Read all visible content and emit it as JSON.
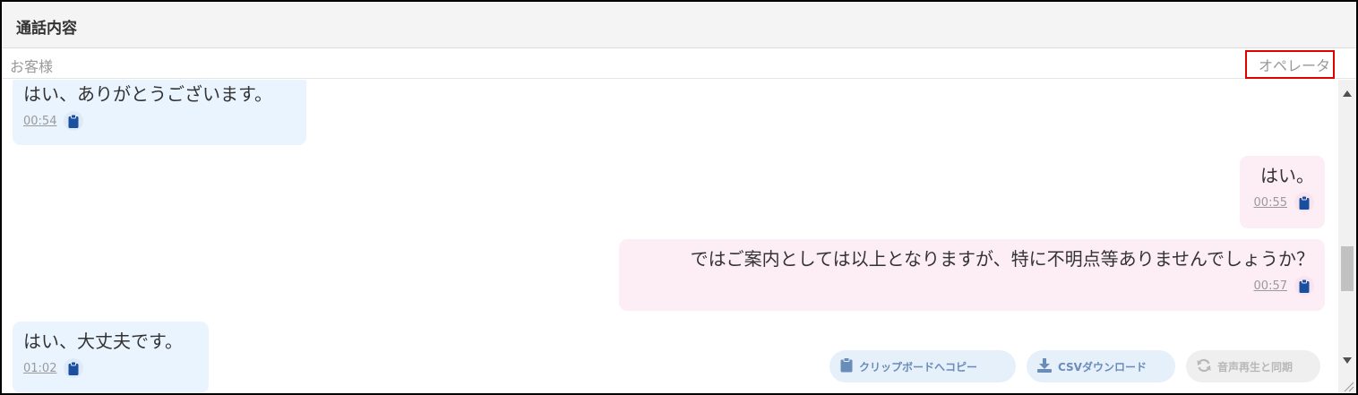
{
  "header": {
    "title": "通話内容"
  },
  "speakers": {
    "customer": "お客様",
    "operator": "オペレータ"
  },
  "messages": [
    {
      "speaker": "customer",
      "text": "はい、ありがとうございます。",
      "time": "00:54"
    },
    {
      "speaker": "operator",
      "text": "はい。",
      "time": "00:55"
    },
    {
      "speaker": "operator",
      "text": "ではご案内としては以上となりますが、特に不明点等ありませんでしょうか？",
      "time": "00:57"
    },
    {
      "speaker": "customer",
      "text": "はい、大丈夫です。",
      "time": "01:02"
    }
  ],
  "actions": {
    "copy": "クリップボードへコピー",
    "csv": "CSVダウンロード",
    "sync": "音声再生と同期"
  },
  "colors": {
    "customer_bubble": "#eaf4ff",
    "operator_bubble": "#fdeef5",
    "icon_blue": "#1a4fa0",
    "highlight": "#e00000"
  }
}
